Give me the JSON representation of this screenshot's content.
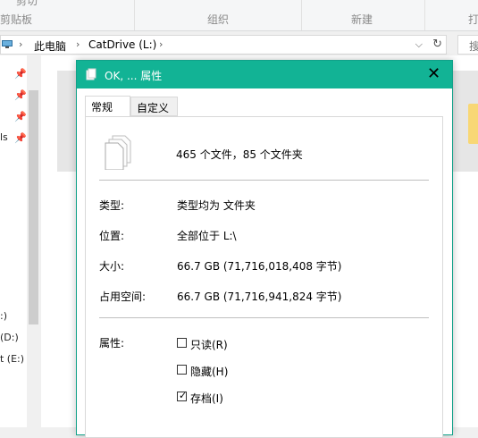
{
  "ribbon": {
    "groups": [
      "剪贴板",
      "组织",
      "新建",
      "打"
    ],
    "partial_top_left": "剪切",
    "partial_top_right": "Q"
  },
  "address": {
    "crumbs": [
      "此电脑",
      "CatDrive (L:)"
    ],
    "search_placeholder": "搜"
  },
  "nav": {
    "items": [
      "ls",
      ":)",
      "(D:)",
      "t (E:)"
    ]
  },
  "dialog": {
    "title": "OK, ... 属性",
    "tabs": [
      "常规",
      "自定义"
    ],
    "summary": "465 个文件，85 个文件夹",
    "rows": [
      {
        "label": "类型:",
        "value": "类型均为 文件夹"
      },
      {
        "label": "位置:",
        "value": "全部位于 L:\\"
      },
      {
        "label": "大小:",
        "value": "66.7 GB (71,716,018,408 字节)"
      },
      {
        "label": "占用空间:",
        "value": "66.7 GB (71,716,941,824 字节)"
      }
    ],
    "attributes_label": "属性:",
    "attributes": [
      {
        "label": "只读(R)",
        "checked": false
      },
      {
        "label": "隐藏(H)",
        "checked": false
      },
      {
        "label": "存档(I)",
        "checked": true
      }
    ]
  },
  "colors": {
    "titlebar": "#12b395",
    "accent_border": "#11a189"
  }
}
